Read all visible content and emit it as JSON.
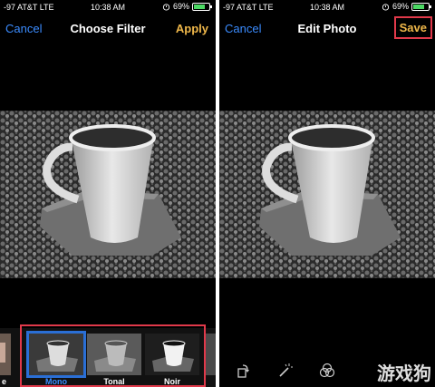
{
  "left_screen": {
    "status": {
      "carrier": "-97 AT&T",
      "network": "LTE",
      "time": "10:38 AM",
      "battery": "69%",
      "battery_level": 0.69
    },
    "nav": {
      "cancel": "Cancel",
      "title": "Choose Filter",
      "apply": "Apply"
    },
    "filters": [
      {
        "label": "e"
      },
      {
        "label": "Mono",
        "selected": true
      },
      {
        "label": "Tonal"
      },
      {
        "label": "Noir"
      }
    ]
  },
  "right_screen": {
    "status": {
      "carrier": "-97 AT&T",
      "network": "LTE",
      "time": "10:38 AM",
      "battery": "69%",
      "battery_level": 0.69
    },
    "nav": {
      "cancel": "Cancel",
      "title": "Edit Photo",
      "save": "Save"
    },
    "toolbar": [
      {
        "icon": "rotate-icon"
      },
      {
        "icon": "magic-wand-icon"
      },
      {
        "icon": "filters-icon"
      }
    ]
  },
  "watermark": "游戏狗",
  "colors": {
    "accent_blue": "#3b8cff",
    "accent_orange": "#f0b84a",
    "highlight_red": "#e0394a",
    "battery_green": "#4cd964"
  }
}
